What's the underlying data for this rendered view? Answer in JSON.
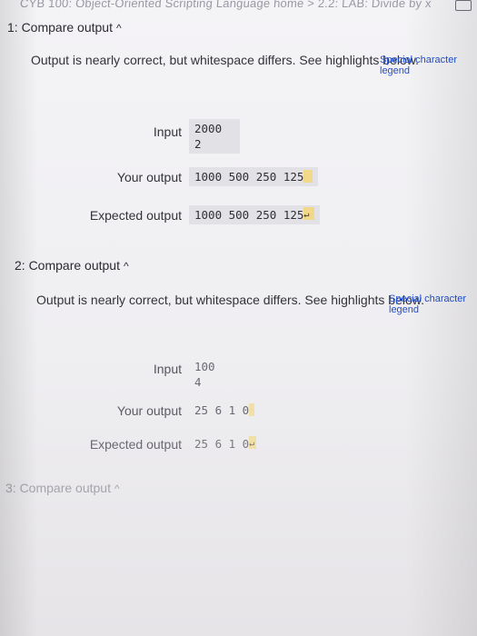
{
  "top_strip": {
    "text": "CYB 100: Object-Oriented Scripting Language home > 2.2: LAB: Divide by x"
  },
  "section1": {
    "title": "1: Compare output",
    "message": "Output is nearly correct, but whitespace differs. See highlights below.",
    "legend_link": "Special character legend",
    "input_label": "Input",
    "input_lines": [
      "2000",
      "2"
    ],
    "your_output_label": "Your output",
    "your_output": "1000 500 250 125",
    "expected_output_label": "Expected output",
    "expected_output": "1000 500 250 125",
    "newline_symbol": "↵"
  },
  "section2": {
    "title": "2: Compare output",
    "message": "Output is nearly correct, but whitespace differs. See highlights below.",
    "legend_link": "Special character legend",
    "input_label": "Input",
    "input_lines": [
      "100",
      "4"
    ],
    "your_output_label": "Your output",
    "your_output": "25 6 1 0",
    "expected_output_label": "Expected output",
    "expected_output": "25 6 1 0",
    "newline_symbol": "↵"
  },
  "section3": {
    "title": "3: Compare output"
  },
  "icons": {
    "caret": "caret-up-icon",
    "window": "window-icon"
  },
  "colors": {
    "highlight": "#f2d98a",
    "link": "#1f4fd1",
    "output_bg": "#e1e1e6"
  }
}
